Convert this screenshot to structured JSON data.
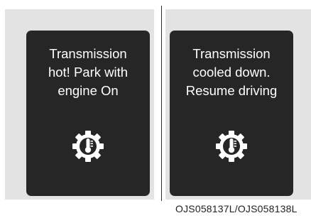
{
  "panels": [
    {
      "message": [
        "Transmission",
        "hot! Park with",
        "engine On"
      ],
      "icon": "transmission-temperature-warning-icon"
    },
    {
      "message": [
        "Transmission",
        "cooled down.",
        "Resume driving"
      ],
      "icon": "transmission-temperature-warning-icon"
    }
  ],
  "image_code": "OJS058137L/OJS058138L",
  "colors": {
    "screen": "#262626",
    "panel_background": "#e3e3e3",
    "text": "#ffffff"
  }
}
